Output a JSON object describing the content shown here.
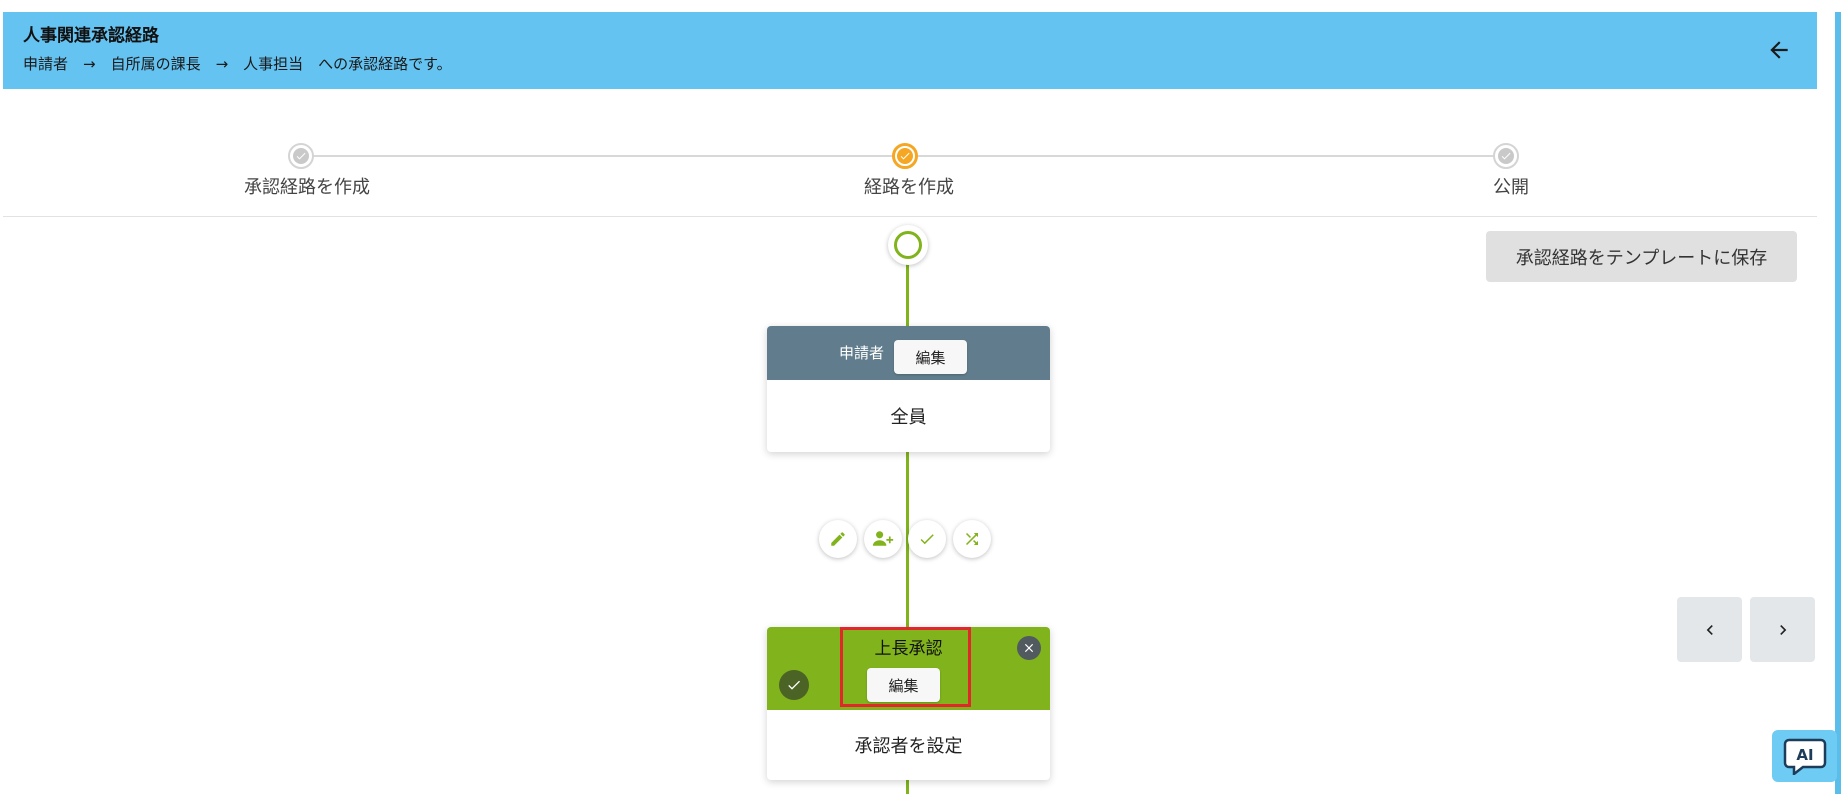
{
  "header": {
    "title": "人事関連承認経路",
    "description": "申請者　→　自所属の課長　→　人事担当　への承認経路です。"
  },
  "stepper": {
    "steps": [
      {
        "label": "承認経路を作成",
        "state": "done"
      },
      {
        "label": "経路を作成",
        "state": "active"
      },
      {
        "label": "公開",
        "state": "done"
      }
    ]
  },
  "toolbar": {
    "save_template_label": "承認経路をテンプレートに保存"
  },
  "flow": {
    "applicant_node": {
      "title": "申請者",
      "edit_label": "編集",
      "body": "全員"
    },
    "actions": [
      {
        "icon": "pencil-icon"
      },
      {
        "icon": "add-user-icon"
      },
      {
        "icon": "check-icon"
      },
      {
        "icon": "shuffle-icon"
      }
    ],
    "approval_node": {
      "title": "上長承認",
      "edit_label": "編集",
      "body": "承認者を設定"
    }
  },
  "colors": {
    "header_bg": "#65c3f1",
    "flow_green": "#80b31c",
    "applicant_head": "#617d8d",
    "active_step": "#f5a623",
    "highlight": "#e1262c"
  },
  "ai_button": {
    "label": "AI"
  }
}
